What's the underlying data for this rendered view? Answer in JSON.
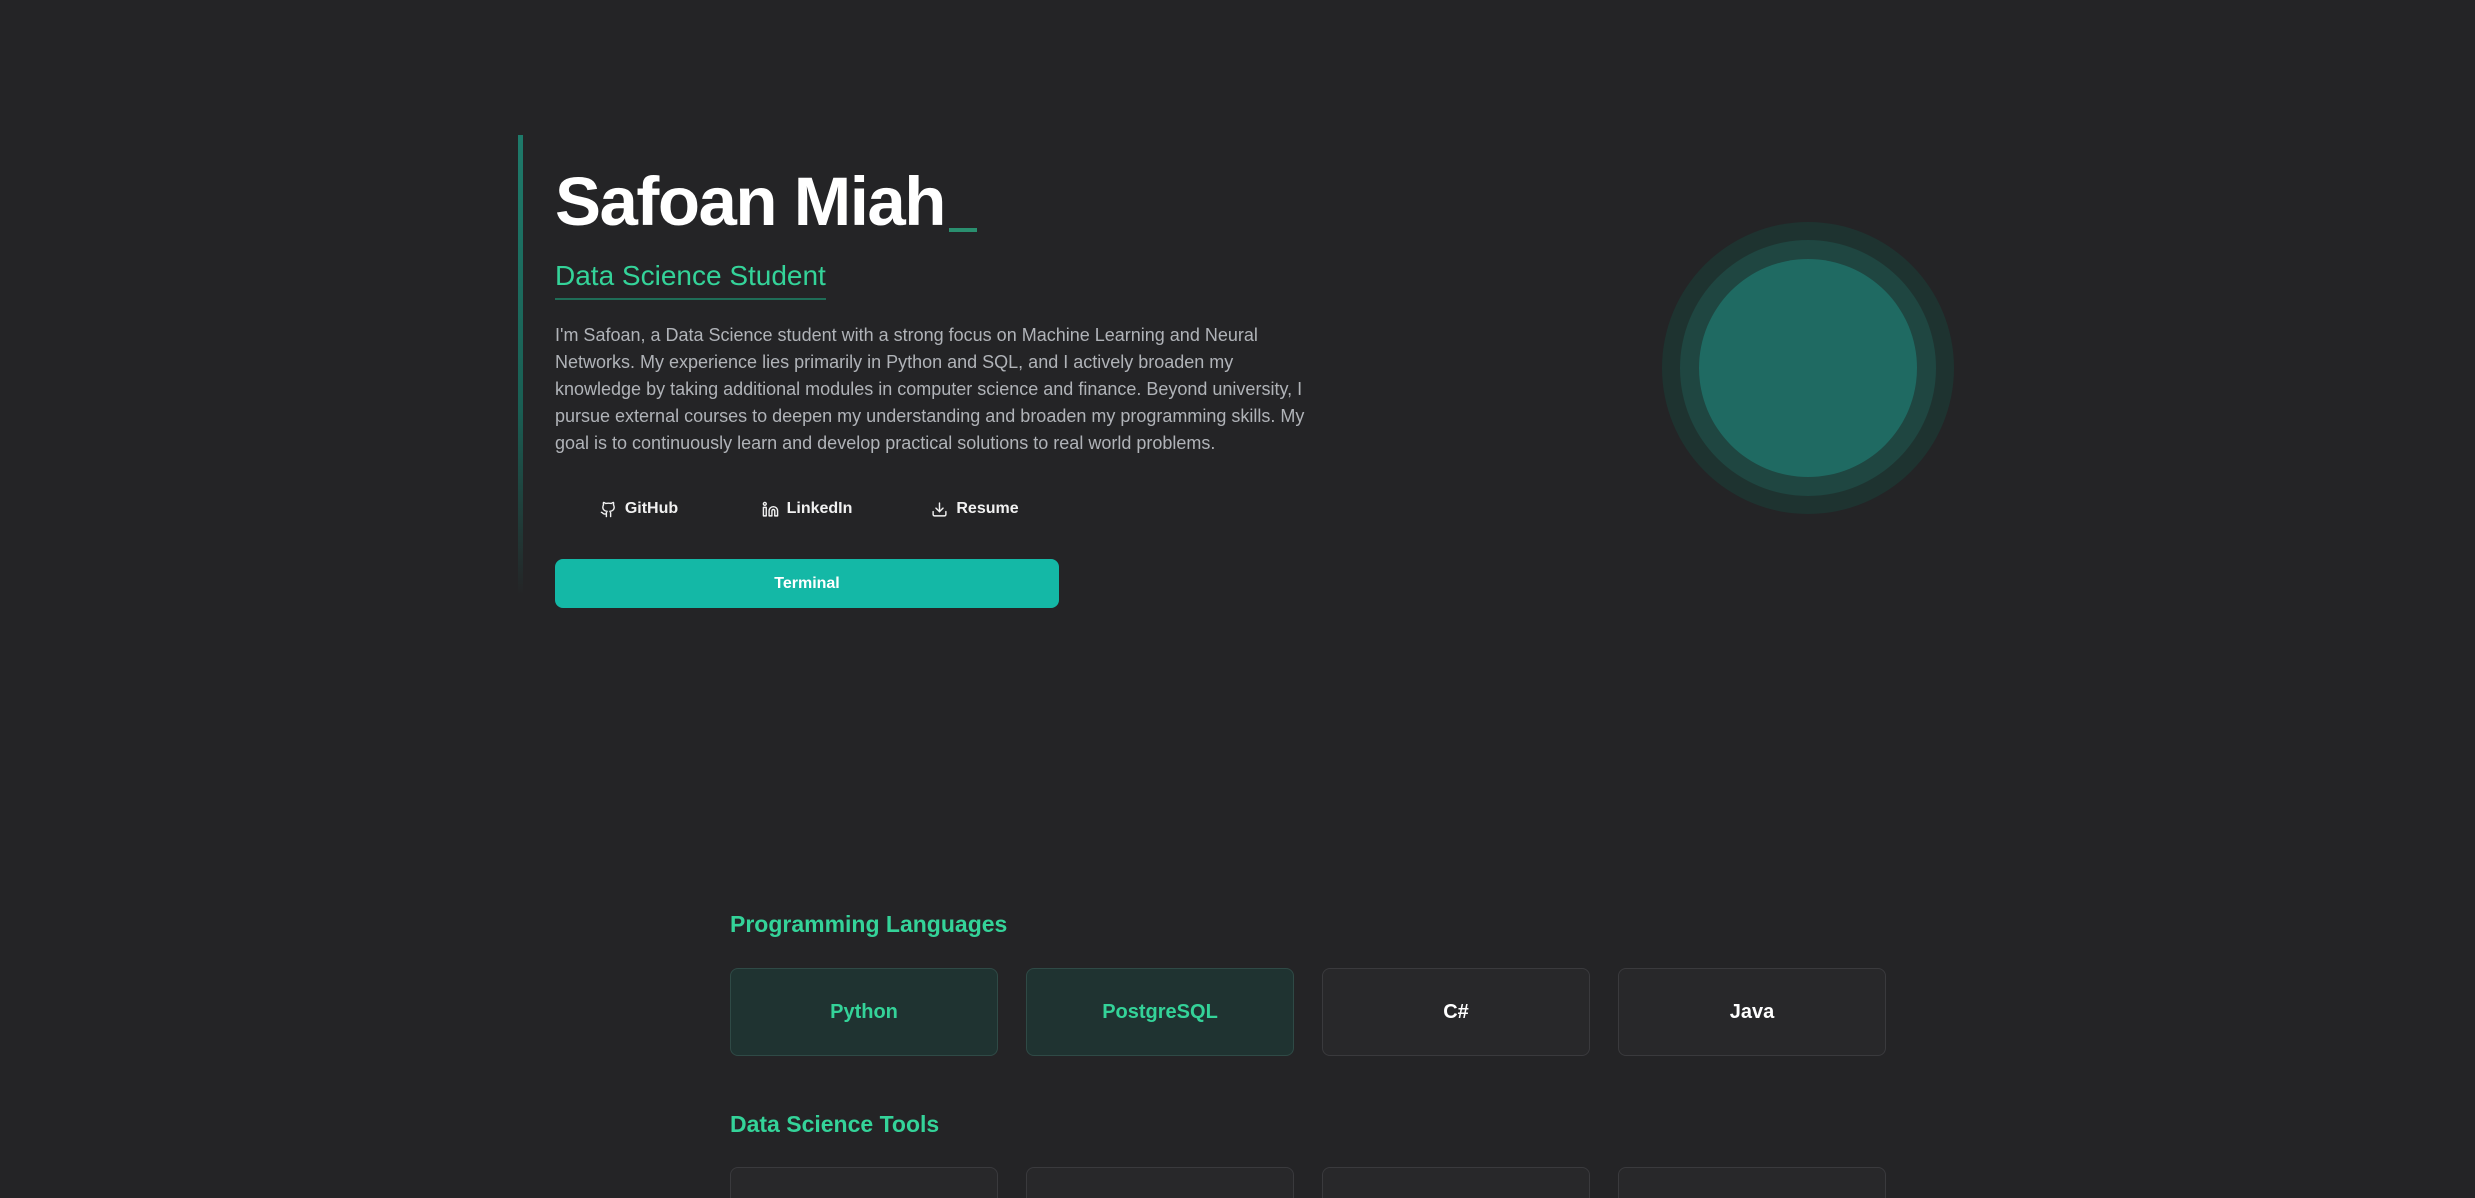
{
  "hero": {
    "name": "Safoan Miah",
    "subtitle": "Data Science Student",
    "bio": "I'm Safoan, a Data Science student with a strong focus on Machine Learning and Neural Networks. My experience lies primarily in Python and SQL, and I actively broaden my knowledge by taking additional modules in computer science and finance. Beyond university, I pursue external courses to deepen my understanding and broaden my programming skills. My goal is to continuously learn and develop practical solutions to real world problems.",
    "links": [
      {
        "label": "GitHub",
        "icon": "github-icon"
      },
      {
        "label": "LinkedIn",
        "icon": "linkedin-icon"
      },
      {
        "label": "Resume",
        "icon": "download-icon"
      }
    ],
    "terminal_label": "Terminal"
  },
  "skills": {
    "programming_title": "Programming Languages",
    "programming": [
      "Python",
      "PostgreSQL",
      "C#",
      "Java"
    ],
    "ds_tools_title": "Data Science Tools"
  },
  "colors": {
    "accent": "#34d399",
    "button": "#14b8a6",
    "background": "#242426"
  }
}
